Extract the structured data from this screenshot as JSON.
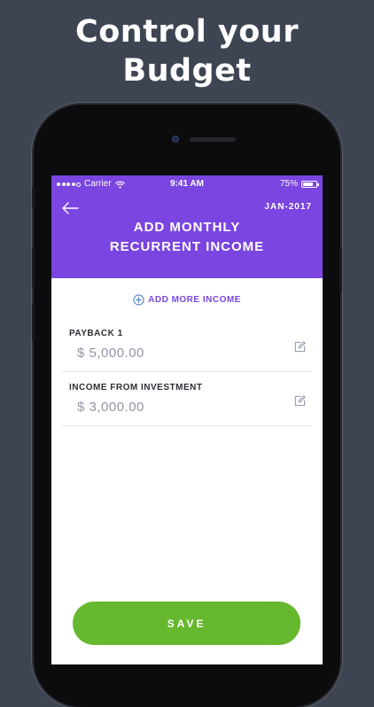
{
  "promo": {
    "headline_line1": "Control your",
    "headline_line2": "Budget"
  },
  "status_bar": {
    "carrier": "Carrier",
    "time": "9:41 AM",
    "battery": "75%",
    "battery_level": 0.75
  },
  "header": {
    "date": "JAN-2017",
    "title_line1": "ADD MONTHLY",
    "title_line2": "RECURRENT INCOME"
  },
  "add_more": {
    "label": "ADD MORE INCOME"
  },
  "incomes": [
    {
      "label": "PAYBACK 1",
      "amount": "$ 5,000.00"
    },
    {
      "label": "INCOME FROM INVESTMENT",
      "amount": "$ 3,000.00"
    }
  ],
  "actions": {
    "save_label": "SAVE"
  },
  "icons": {
    "back": "arrow-left-icon",
    "add": "plus-circle-icon",
    "edit": "pencil-square-icon",
    "wifi": "wifi-icon",
    "battery": "battery-icon"
  },
  "colors": {
    "background": "#3d4452",
    "accent": "#7a45e0",
    "save": "#66b82e",
    "amount_text": "#8e95a4"
  }
}
